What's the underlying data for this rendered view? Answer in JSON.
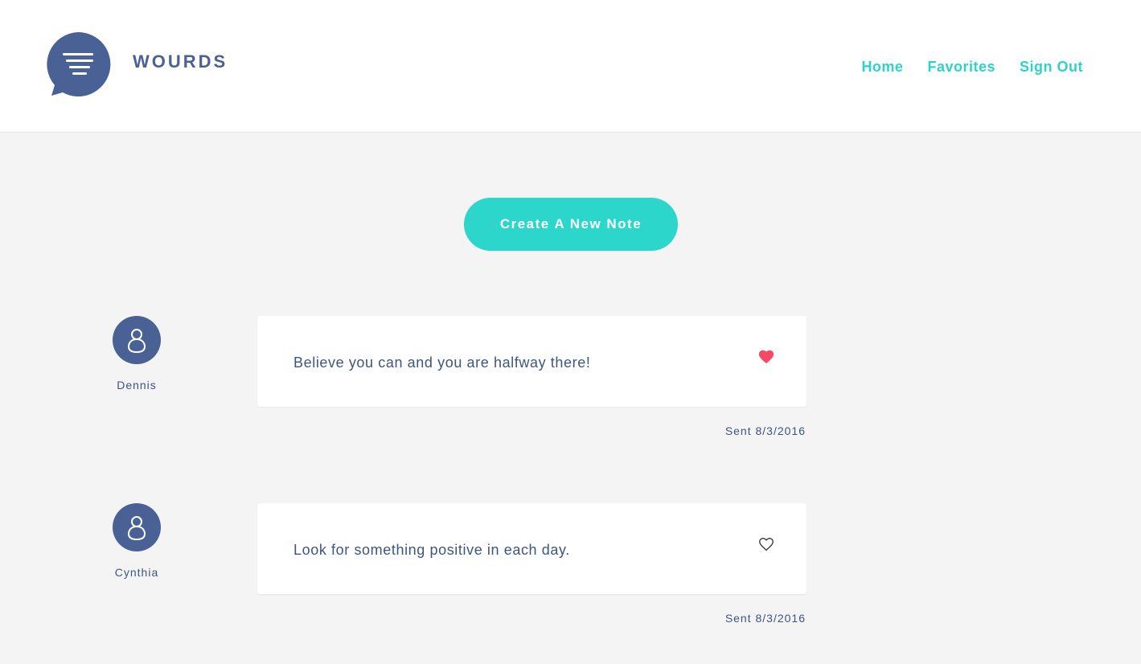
{
  "header": {
    "brand": "WOURDS",
    "nav": [
      {
        "label": "Home"
      },
      {
        "label": "Favorites"
      },
      {
        "label": "Sign Out"
      }
    ]
  },
  "main": {
    "create_label": "Create A New Note",
    "notes": [
      {
        "author": "Dennis",
        "text": "Believe you can and you are halfway there!",
        "sent": "Sent 8/3/2016",
        "favorited": true
      },
      {
        "author": "Cynthia",
        "text": "Look for something positive in each day.",
        "sent": "Sent 8/3/2016",
        "favorited": false
      }
    ]
  },
  "colors": {
    "brand": "#4a6195",
    "accent": "#2dd6cb",
    "heart": "#f44a62",
    "background": "#f4f4f4"
  },
  "icons": {
    "logo": "speech-bubble-lines-icon",
    "avatar": "user-icon",
    "favorite": "heart-icon"
  }
}
